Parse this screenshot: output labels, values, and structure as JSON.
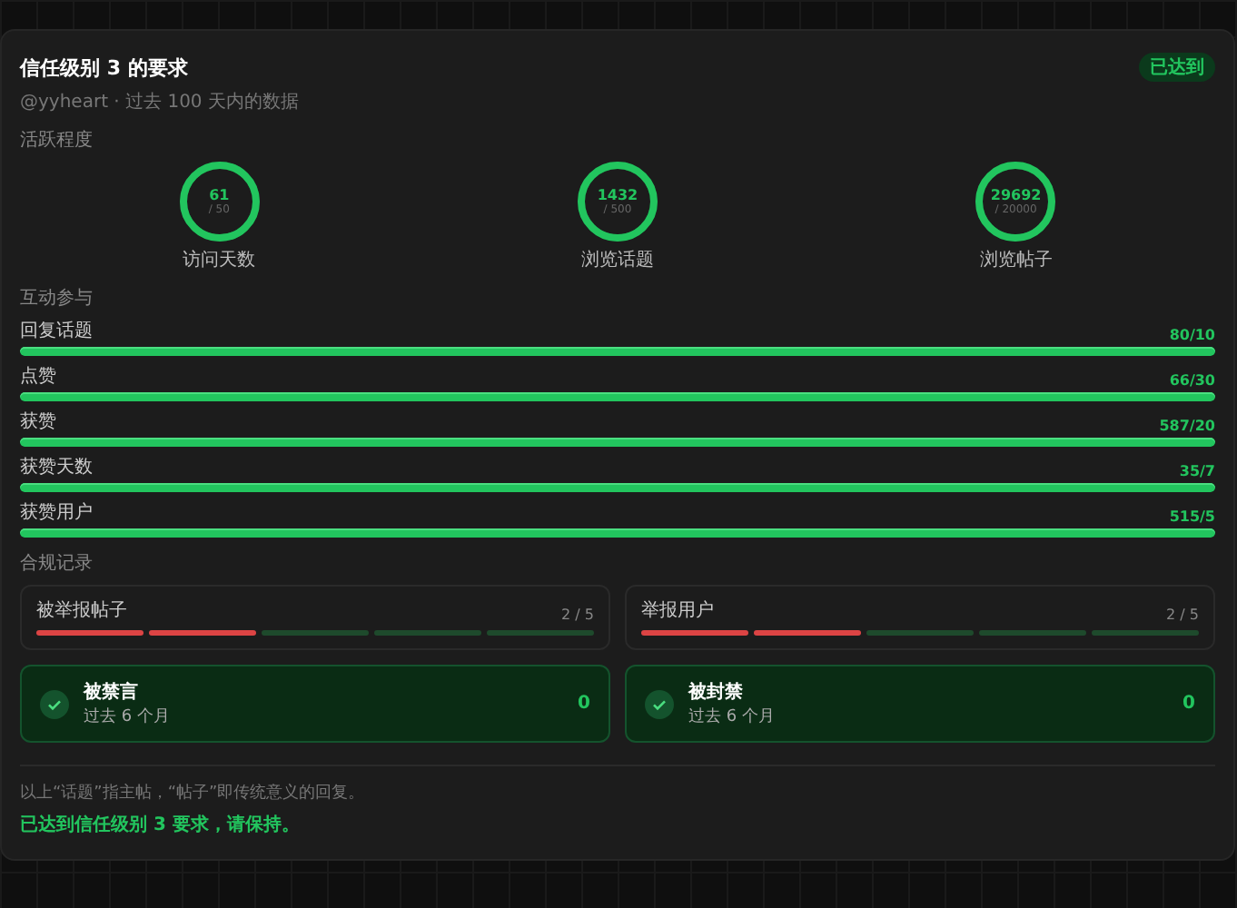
{
  "header": {
    "title": "信任级别 3 的要求",
    "badge": "已达到",
    "subtitle": "@yyheart · 过去 100 天内的数据"
  },
  "activity": {
    "label": "活跃程度",
    "rings": [
      {
        "value": "61",
        "target": "/ 50",
        "label": "访问天数",
        "level": 1
      },
      {
        "value": "1432",
        "target": "/ 500",
        "label": "浏览话题",
        "level": 1
      },
      {
        "value": "29692",
        "target": "/ 20000",
        "label": "浏览帖子",
        "level": 1
      }
    ]
  },
  "interaction": {
    "label": "互动参与",
    "bars": [
      {
        "name": "回复话题",
        "reading": "80/10",
        "level": 1
      },
      {
        "name": "点赞",
        "reading": "66/30",
        "level": 1
      },
      {
        "name": "获赞",
        "reading": "587/20",
        "level": 1
      },
      {
        "name": "获赞天数",
        "reading": "35/7",
        "level": 1
      },
      {
        "name": "获赞用户",
        "reading": "515/5",
        "level": 1
      }
    ]
  },
  "compliance": {
    "label": "合规记录",
    "reports": [
      {
        "name": "被举报帖子",
        "reading": "2 / 5",
        "segments": [
          {
            "filled": true
          },
          {
            "filled": true
          },
          {
            "filled": false
          },
          {
            "filled": false
          },
          {
            "filled": false
          }
        ]
      },
      {
        "name": "举报用户",
        "reading": "2 / 5",
        "segments": [
          {
            "filled": true
          },
          {
            "filled": true
          },
          {
            "filled": false
          },
          {
            "filled": false
          },
          {
            "filled": false
          }
        ]
      }
    ],
    "statuses": [
      {
        "title": "被禁言",
        "period": "过去 6 个月",
        "value": "0",
        "passed": true
      },
      {
        "title": "被封禁",
        "period": "过去 6 个月",
        "value": "0",
        "passed": true
      }
    ]
  },
  "footer": {
    "note": "以上“话题”指主帖，“帖子”即传统意义的回复。",
    "result": "已达到信任级别 3 要求，请保持。"
  }
}
